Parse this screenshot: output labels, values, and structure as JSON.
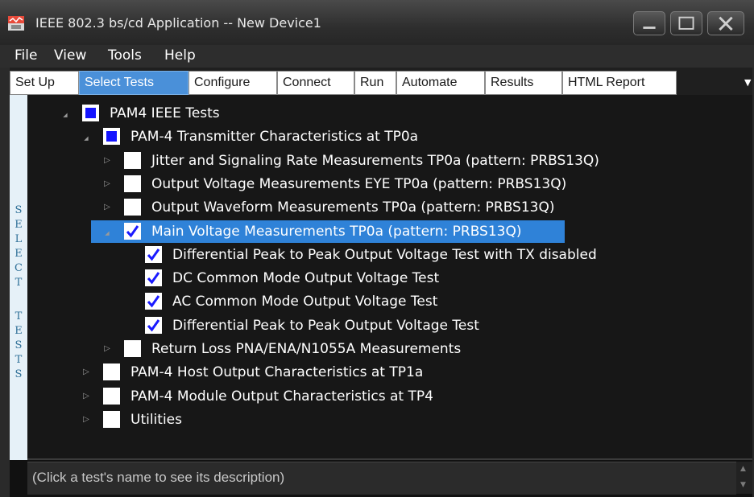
{
  "window": {
    "title": "IEEE 802.3 bs/cd Application -- New Device1"
  },
  "menu": [
    "File",
    "View",
    "Tools",
    "Help"
  ],
  "tabs": [
    {
      "label": "Set Up",
      "active": false
    },
    {
      "label": "Select Tests",
      "active": true
    },
    {
      "label": "Configure",
      "active": false
    },
    {
      "label": "Connect",
      "active": false
    },
    {
      "label": "Run",
      "active": false
    },
    {
      "label": "Automate",
      "active": false
    },
    {
      "label": "Results",
      "active": false
    },
    {
      "label": "HTML Report",
      "active": false
    }
  ],
  "side_panel": {
    "label": "SELECT TESTS"
  },
  "tree": [
    {
      "label": "PAM4 IEEE Tests",
      "state": "partial",
      "expander": "expanded",
      "level": 0
    },
    {
      "label": "PAM-4 Transmitter Characteristics at TP0a",
      "state": "partial",
      "expander": "expanded",
      "level": 1
    },
    {
      "label": "Jitter and Signaling Rate Measurements TP0a (pattern: PRBS13Q)",
      "state": "unchecked",
      "expander": "collapsed",
      "level": 2
    },
    {
      "label": "Output Voltage Measurements EYE TP0a (pattern: PRBS13Q)",
      "state": "unchecked",
      "expander": "collapsed",
      "level": 2
    },
    {
      "label": "Output Waveform Measurements TP0a (pattern: PRBS13Q)",
      "state": "unchecked",
      "expander": "collapsed",
      "level": 2
    },
    {
      "label": "Main Voltage Measurements TP0a (pattern: PRBS13Q)",
      "state": "checked",
      "expander": "expanded",
      "level": 2,
      "selected": true
    },
    {
      "label": "Differential Peak to Peak Output Voltage Test with TX disabled",
      "state": "checked",
      "expander": "none",
      "level": 3
    },
    {
      "label": "DC Common Mode Output Voltage Test",
      "state": "checked",
      "expander": "none",
      "level": 3
    },
    {
      "label": "AC Common Mode Output Voltage Test",
      "state": "checked",
      "expander": "none",
      "level": 3
    },
    {
      "label": "Differential Peak to Peak Output Voltage Test",
      "state": "checked",
      "expander": "none",
      "level": 3
    },
    {
      "label": "Return Loss PNA/ENA/N1055A Measurements",
      "state": "unchecked",
      "expander": "collapsed",
      "level": 2
    },
    {
      "label": "PAM-4 Host Output Characteristics at TP1a",
      "state": "unchecked",
      "expander": "collapsed",
      "level": 1
    },
    {
      "label": "PAM-4 Module Output Characteristics at TP4",
      "state": "unchecked",
      "expander": "collapsed",
      "level": 1
    },
    {
      "label": "Utilities",
      "state": "unchecked",
      "expander": "collapsed",
      "level": 1
    }
  ],
  "description": {
    "placeholder": "(Click a test's name to see its description)"
  },
  "colors": {
    "accent": "#2f82d8",
    "checkbox_partial": "#1414ff",
    "check_mark": "#1a1aff"
  }
}
